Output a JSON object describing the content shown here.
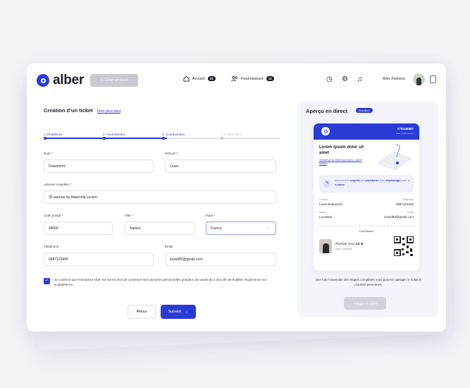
{
  "brand": {
    "name": "alber",
    "color": "#2a3bd6"
  },
  "header": {
    "new_button": "Créer un ticket",
    "nav": [
      {
        "label": "Accueil",
        "count": "20",
        "icon": "home-icon"
      },
      {
        "label": "Fournisseurs",
        "count": "12",
        "icon": "team-icon"
      }
    ],
    "tools": [
      "clock-icon",
      "gear-icon",
      "bell-icon"
    ],
    "user_name": "Marc Pacheco"
  },
  "form": {
    "title": "Creation d'un ticket",
    "finish_later": "Finir plus tard",
    "steps": [
      {
        "label": "1. Problèmes",
        "done": true
      },
      {
        "label": "2. Fournisseurs",
        "done": true
      },
      {
        "label": "3. Coordonnées",
        "done": true
      },
      {
        "label": "4. Confirmation",
        "done": false
      }
    ],
    "fields": {
      "nom": {
        "label": "Nom *",
        "value": "Deaumont"
      },
      "prenom": {
        "label": "Prénom *",
        "value": "Louis"
      },
      "adresse": {
        "label": "Adresse complète *",
        "value": "35 avenue du Maréchal Leclerc"
      },
      "code_postal": {
        "label": "Code postal *",
        "value": "44000"
      },
      "ville": {
        "label": "Ville *",
        "value": "Nantes"
      },
      "pays": {
        "label": "Pays *",
        "value": "France"
      },
      "telephone": {
        "label": "Téléphone",
        "value": "0687123400"
      },
      "email": {
        "label": "Email",
        "value": "louisd83@gmail.com"
      }
    },
    "consent": "Je confirme que l'entreprise Alber SA est en droit de conserver mes données personnelles pendant une durée de 2 ans afin de fluidifier l'expérience sur la plateforme.",
    "back_label": "Retour",
    "next_label": "Suivant"
  },
  "preview": {
    "title": "Aperçu en direct",
    "badge": "Brouillon",
    "ticket": {
      "id": "#7D345887",
      "date": "Date d'intervention",
      "name": "Lorem ipsum dolor sit amet",
      "address": "35 avenue du Maréchal Leclerc, 44000 Nantes",
      "info_prefix": "Intervention ",
      "info_urgency": "urgente",
      "info_mid": " de ",
      "info_trade": "plomberie",
      "info_type_prefix": "type ",
      "info_type": "dépannage",
      "info_room_prefix": " pour la ",
      "info_room": "cuisine",
      "contact_label": "Contact",
      "contact_value": "Louis Deaumont",
      "phone_label": "Téléphone",
      "phone_value": "0687123400",
      "status_label": "Statut",
      "status_value": "Locataire",
      "email_label": "Email",
      "email_value": "louisd83@gmail.com",
      "supplier_title": "Fournisseur",
      "supplier_name": "Plumber SAS",
      "supplier_rating": "4.5 ★",
      "supplier_city": "Paul Lamarelle"
    },
    "share_text": "Une fois l'ensemble des étapes complétés vous pourrez partager le ticket à d'autres personnes",
    "share_button": "Partager le ticket"
  }
}
